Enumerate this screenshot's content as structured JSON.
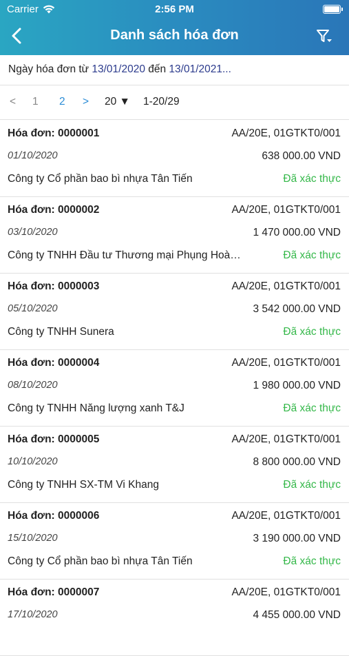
{
  "status_bar": {
    "carrier": "Carrier",
    "time": "2:56 PM"
  },
  "nav": {
    "title": "Danh sách hóa đơn",
    "back_icon": "chevron-left-icon",
    "filter_icon": "filter-icon"
  },
  "date_range": {
    "prefix": "Ngày hóa đơn từ ",
    "from": "13/01/2020",
    "middle": " đến ",
    "to": "13/01/2021..."
  },
  "pagination": {
    "prev": "<",
    "pages": [
      "1",
      "2"
    ],
    "current_page": "2",
    "next": ">",
    "page_size": "20 ▼",
    "range": "1-20/29"
  },
  "colors": {
    "header_start": "#2aa6c2",
    "header_end": "#2a76b8",
    "status_verified": "#35b84a",
    "date_link": "#2b3a8c",
    "active_page": "#2a8cd6"
  },
  "invoices": [
    {
      "number": "Hóa đơn: 0000001",
      "code": "AA/20E, 01GTKT0/001",
      "date": "01/10/2020",
      "amount": "638 000.00  VND",
      "company": "Công ty Cổ phần bao bì nhựa Tân Tiến",
      "status": "Đã xác thực"
    },
    {
      "number": "Hóa đơn: 0000002",
      "code": "AA/20E, 01GTKT0/001",
      "date": "03/10/2020",
      "amount": "1 470 000.00  VND",
      "company": "Công ty TNHH Đầu tư Thương mại Phụng Hoàng",
      "status": "Đã xác thực"
    },
    {
      "number": "Hóa đơn: 0000003",
      "code": "AA/20E, 01GTKT0/001",
      "date": "05/10/2020",
      "amount": "3 542 000.00  VND",
      "company": "Công ty TNHH Sunera",
      "status": "Đã xác thực"
    },
    {
      "number": "Hóa đơn: 0000004",
      "code": "AA/20E, 01GTKT0/001",
      "date": "08/10/2020",
      "amount": "1 980 000.00  VND",
      "company": "Công ty TNHH Năng lượng xanh T&J",
      "status": "Đã xác thực"
    },
    {
      "number": "Hóa đơn: 0000005",
      "code": "AA/20E, 01GTKT0/001",
      "date": "10/10/2020",
      "amount": "8 800 000.00  VND",
      "company": "Công ty TNHH SX-TM Vi Khang",
      "status": "Đã xác thực"
    },
    {
      "number": "Hóa đơn: 0000006",
      "code": "AA/20E, 01GTKT0/001",
      "date": "15/10/2020",
      "amount": "3 190 000.00  VND",
      "company": "Công ty Cổ phần bao bì nhựa Tân Tiến",
      "status": "Đã xác thực"
    },
    {
      "number": "Hóa đơn: 0000007",
      "code": "AA/20E, 01GTKT0/001",
      "date": "17/10/2020",
      "amount": "4 455 000.00  VND",
      "company": "",
      "status": ""
    }
  ]
}
